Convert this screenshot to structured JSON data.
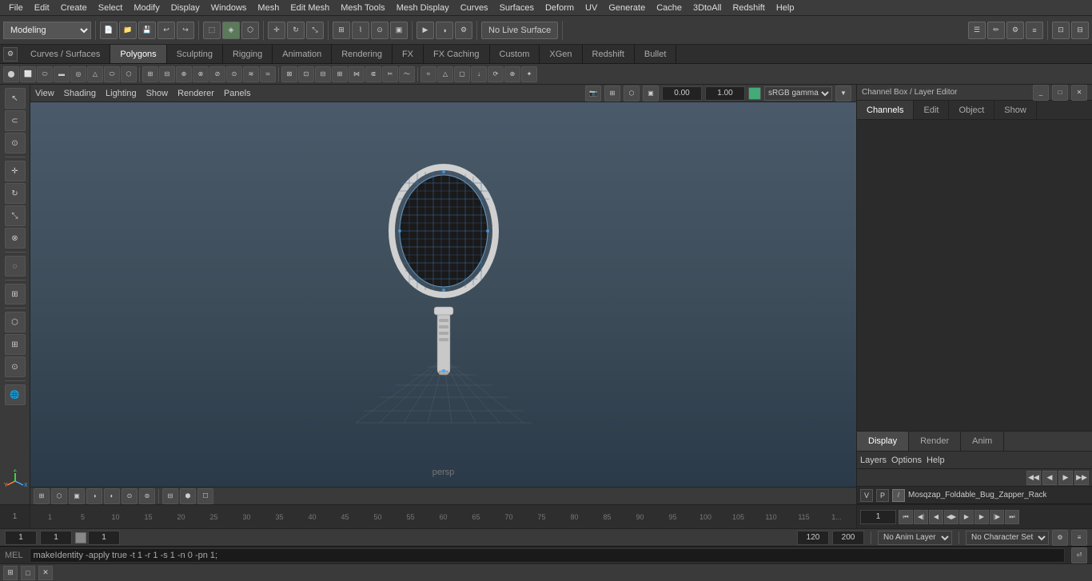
{
  "app": {
    "title": "Autodesk Maya"
  },
  "menu": {
    "items": [
      "File",
      "Edit",
      "Create",
      "Select",
      "Modify",
      "Display",
      "Windows",
      "Mesh",
      "Edit Mesh",
      "Mesh Tools",
      "Mesh Display",
      "Curves",
      "Surfaces",
      "Deform",
      "UV",
      "Generate",
      "Cache",
      "3DtoAll",
      "Redshift",
      "Help"
    ]
  },
  "toolbar1": {
    "workspace_label": "Modeling",
    "live_surface_label": "No Live Surface"
  },
  "workspace_tabs": {
    "items": [
      "Curves / Surfaces",
      "Polygons",
      "Sculpting",
      "Rigging",
      "Animation",
      "Rendering",
      "FX",
      "FX Caching",
      "Custom",
      "XGen",
      "Redshift",
      "Bullet"
    ],
    "active": "Polygons"
  },
  "viewport": {
    "menus": [
      "View",
      "Shading",
      "Lighting",
      "Show",
      "Renderer",
      "Panels"
    ],
    "gamma_val": "0.00",
    "exposure_val": "1.00",
    "gamma_label": "sRGB gamma",
    "persp_label": "persp"
  },
  "channel_box": {
    "title": "Channel Box / Layer Editor",
    "tabs": [
      "Channels",
      "Edit",
      "Object",
      "Show"
    ],
    "display_tabs": [
      "Display",
      "Render",
      "Anim"
    ],
    "active_display_tab": "Display",
    "layer_menus": [
      "Layers",
      "Options",
      "Help"
    ],
    "layer_name": "Mosqzap_Foldable_Bug_Zapper_Rack",
    "layer_v": "V",
    "layer_p": "P"
  },
  "timeline": {
    "ticks": [
      "1",
      "",
      "5",
      "",
      "",
      "10",
      "",
      "",
      "15",
      "",
      "",
      "20",
      "",
      "",
      "25",
      "",
      "",
      "30",
      "",
      "",
      "35",
      "",
      "",
      "40",
      "",
      "",
      "45",
      "",
      "",
      "50",
      "",
      "",
      "55",
      "",
      "",
      "60",
      "",
      "",
      "65",
      "",
      "",
      "70",
      "",
      "",
      "75",
      "",
      "",
      "80",
      "",
      "",
      "85",
      "",
      "",
      "90",
      "",
      "",
      "95",
      "",
      "",
      "100",
      "",
      "",
      "105",
      "",
      "",
      "110",
      "",
      "",
      "1..."
    ],
    "frame_start": "1",
    "frame_current": "1"
  },
  "status_bar": {
    "frame1": "1",
    "frame2": "1",
    "frame3": "1",
    "anim_layer": "No Anim Layer",
    "char_set": "No Character Set",
    "range_start": "120",
    "range_end": "200"
  },
  "cmd_line": {
    "lang_label": "MEL",
    "command": "makeIdentity -apply true -t 1 -r 1 -s 1 -n 0 -pn 1;"
  },
  "taskbar": {
    "items": []
  }
}
